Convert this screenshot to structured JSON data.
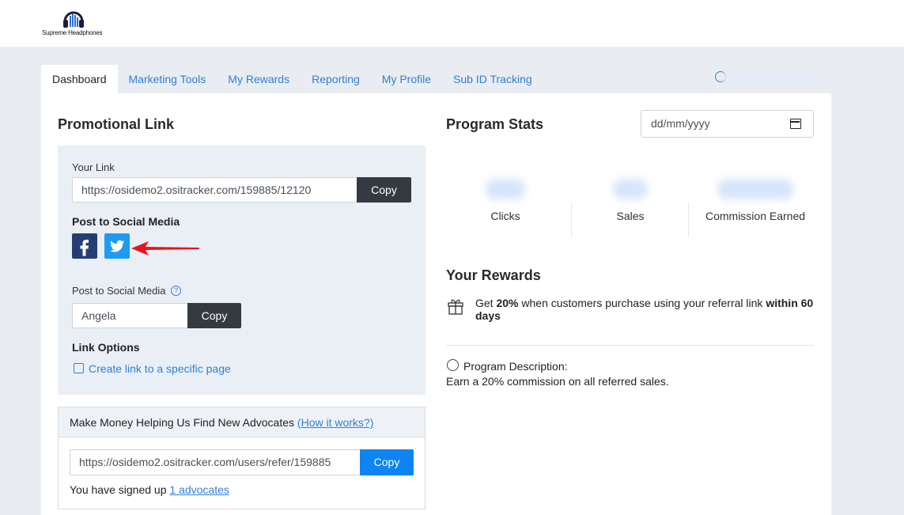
{
  "brand": {
    "name": "Supreme Headphones"
  },
  "tabs": [
    {
      "label": "Dashboard",
      "active": true
    },
    {
      "label": "Marketing Tools"
    },
    {
      "label": "My Rewards"
    },
    {
      "label": "Reporting"
    },
    {
      "label": "My Profile"
    },
    {
      "label": "Sub ID Tracking"
    }
  ],
  "promo": {
    "title": "Promotional Link",
    "your_link_label": "Your Link",
    "your_link_value": "https://osidemo2.ositracker.com/159885/12120",
    "copy_label": "Copy",
    "post_social_label": "Post to Social Media",
    "post_social_label_2": "Post to Social Media",
    "help_glyph": "?",
    "coupon_value": "Angela",
    "copy_label_2": "Copy",
    "link_options_label": "Link Options",
    "create_link_label": "Create link to a specific page"
  },
  "advocates": {
    "head_text": "Make Money Helping Us Find New Advocates ",
    "how_it_works": "(How it works?)",
    "refer_link": "https://osidemo2.ositracker.com/users/refer/159885",
    "copy_label": "Copy",
    "signed_text": "You have signed up ",
    "advocates_link": "1 advocates"
  },
  "stats": {
    "title": "Program Stats",
    "date_placeholder": "dd/mm/yyyy",
    "items": [
      {
        "name": "Clicks"
      },
      {
        "name": "Sales"
      },
      {
        "name": "Commission Earned"
      }
    ]
  },
  "rewards": {
    "title": "Your Rewards",
    "line_part1": "Get ",
    "line_bold1": "20%",
    "line_part2": " when customers purchase using your referral link ",
    "line_bold2": "within 60 days",
    "desc_head": "Program Description:",
    "desc_text": "Earn a 20% commission on all referred sales."
  },
  "colors": {
    "accent": "#2f80d8",
    "copy_dark": "#343a40",
    "copy_blue": "#0d84f1",
    "facebook": "#243e74",
    "twitter": "#1d9bf0",
    "arrow": "#e8141b",
    "link_box_bg": "#eaeff6",
    "page_bg": "#e9ecf1"
  },
  "icons": [
    "headphones-logo-icon",
    "user-icon",
    "facebook-icon",
    "twitter-icon",
    "red-arrow-icon",
    "help-icon",
    "edit-icon",
    "calendar-icon",
    "gift-icon",
    "check-circle-icon"
  ]
}
